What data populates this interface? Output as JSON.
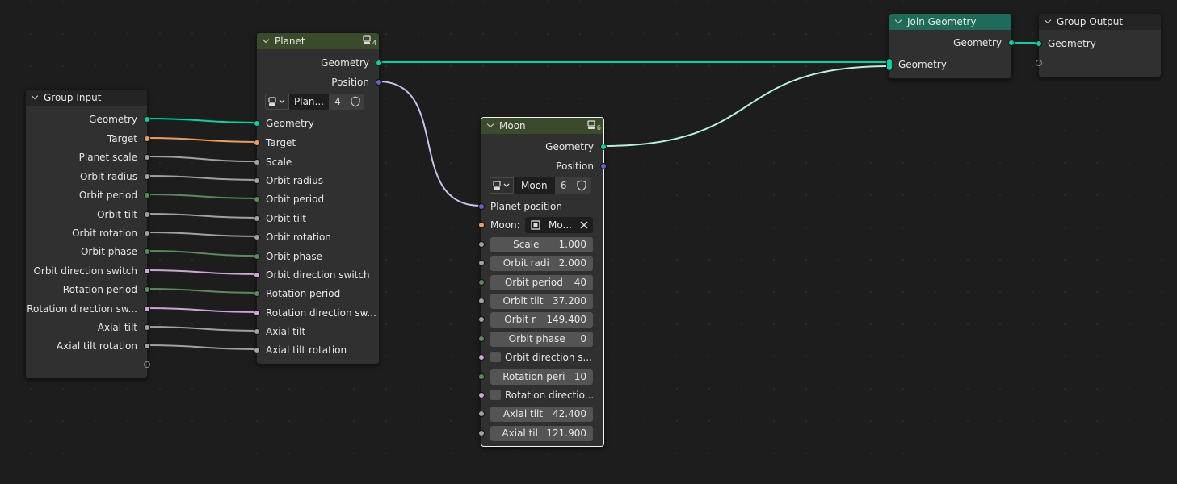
{
  "colors": {
    "geometry": "#00d6a3",
    "vector": "#6363c7",
    "object": "#ed9e5c",
    "float": "#a1a1a1",
    "integer": "#598c5c",
    "boolean": "#cca6d6"
  },
  "group_input": {
    "title": "Group Input",
    "outputs": [
      "Geometry",
      "Target",
      "Planet scale",
      "Orbit radius",
      "Orbit period",
      "Orbit tilt",
      "Orbit rotation",
      "Orbit phase",
      "Orbit direction switch",
      "Rotation period",
      "Rotation direction sw...",
      "Axial tilt",
      "Axial tilt rotation"
    ]
  },
  "planet": {
    "title": "Planet",
    "user_count": "4",
    "outputs": [
      "Geometry",
      "Position"
    ],
    "group_name": "Plan...",
    "group_users": "4",
    "inputs": [
      "Geometry",
      "Target",
      "Scale",
      "Orbit radius",
      "Orbit period",
      "Orbit tilt",
      "Orbit rotation",
      "Orbit phase",
      "Orbit direction switch",
      "Rotation period",
      "Rotation direction sw...",
      "Axial tilt",
      "Axial tilt rotation"
    ]
  },
  "moon": {
    "title": "Moon",
    "user_count": "6",
    "outputs": [
      "Geometry",
      "Position"
    ],
    "group_name": "Moon",
    "group_users": "6",
    "planet_position_label": "Planet position",
    "moon_label": "Moon:",
    "moon_object": "Mo...",
    "fields": [
      {
        "label": "Scale",
        "value": "1.000"
      },
      {
        "label": "Orbit radi",
        "value": "2.000"
      },
      {
        "label": "Orbit period",
        "value": "40"
      },
      {
        "label": "Orbit tilt",
        "value": "37.200"
      },
      {
        "label": "Orbit r",
        "value": "149.400"
      },
      {
        "label": "Orbit phase",
        "value": "0"
      },
      {
        "label": "Orbit direction s...",
        "checkbox": true
      },
      {
        "label": "Rotation peri",
        "value": "10"
      },
      {
        "label": "Rotation directio...",
        "checkbox": true
      },
      {
        "label": "Axial tilt",
        "value": "42.400"
      },
      {
        "label": "Axial til",
        "value": "121.900"
      }
    ]
  },
  "join_geometry": {
    "title": "Join Geometry",
    "output": "Geometry",
    "input": "Geometry"
  },
  "group_output": {
    "title": "Group Output",
    "input": "Geometry"
  }
}
